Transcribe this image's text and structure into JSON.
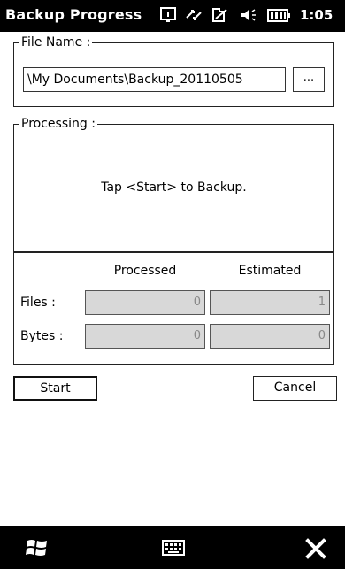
{
  "window": {
    "title": "Backup Progress",
    "clock": "1:05",
    "status_icons": [
      "connectivity-icon",
      "data-sync-icon",
      "signal-icon",
      "speaker-icon",
      "battery-icon"
    ]
  },
  "file_group": {
    "legend": "File Name :",
    "path_value": "\\My Documents\\Backup_20110505",
    "browse_label": "..."
  },
  "processing_group": {
    "legend": "Processing :",
    "message": "Tap <Start> to Backup."
  },
  "stats": {
    "columns": [
      "Processed",
      "Estimated"
    ],
    "rows": [
      {
        "label": "Files :",
        "processed": "0",
        "estimated": "1"
      },
      {
        "label": "Bytes :",
        "processed": "0",
        "estimated": "0"
      }
    ]
  },
  "buttons": {
    "start": "Start",
    "cancel": "Cancel"
  },
  "softkeys": [
    "windows-start-icon",
    "keyboard-icon",
    "close-icon"
  ]
}
